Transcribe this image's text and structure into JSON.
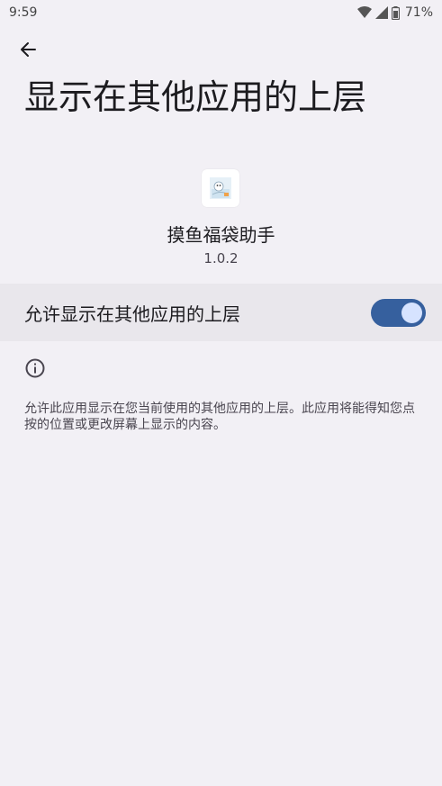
{
  "status_bar": {
    "time": "9:59",
    "battery": "71%"
  },
  "header": {
    "title": "显示在其他应用的上层"
  },
  "app": {
    "name": "摸鱼福袋助手",
    "version": "1.0.2"
  },
  "permission": {
    "label": "允许显示在其他应用的上层",
    "enabled": true
  },
  "info": {
    "text": "允许此应用显示在您当前使用的其他应用的上层。此应用将能得知您点按的位置或更改屏幕上显示的内容。"
  },
  "colors": {
    "background": "#f2f0f5",
    "switch_track": "#36609e",
    "switch_thumb": "#d6e3ff"
  }
}
